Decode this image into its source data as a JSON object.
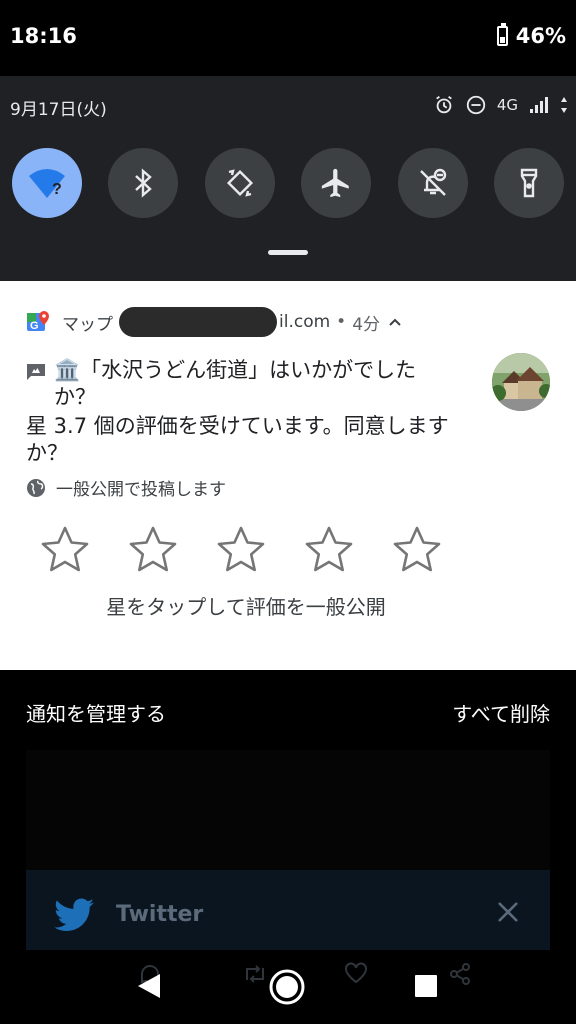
{
  "status_bar": {
    "time": "18:16",
    "battery": "46%",
    "battery_level": 0.46
  },
  "quick_settings": {
    "date": "9月17日(火)",
    "network": "4G",
    "tiles": [
      {
        "name": "wifi",
        "icon": "wifi-icon",
        "active": true
      },
      {
        "name": "bluetooth",
        "icon": "bluetooth-icon",
        "active": false
      },
      {
        "name": "auto-rotate",
        "icon": "rotate-icon",
        "active": false
      },
      {
        "name": "airplane",
        "icon": "airplane-icon",
        "active": false
      },
      {
        "name": "do-not-disturb",
        "icon": "notifications-off-icon",
        "active": false
      },
      {
        "name": "flashlight",
        "icon": "flashlight-icon",
        "active": false
      }
    ],
    "colors": {
      "panel": "#202124",
      "tile": "#3c4043",
      "tile_active": "#8ab4f8"
    }
  },
  "notification": {
    "app_name": "マップ",
    "account_tail": "il.com",
    "separator": "•",
    "time_ago": "4分",
    "title": "🏛️「水沢うどん街道」はいかがでしたか？",
    "body": "星 3.7 個の評価を受けています。同意しますか？",
    "audience": "一般公開で投稿します",
    "rating_hint": "星をタップして評価を一般公開",
    "star_count": 5
  },
  "footer": {
    "manage": "通知を管理する",
    "clear_all": "すべて削除"
  },
  "background_notification": {
    "app_name": "Twitter"
  }
}
